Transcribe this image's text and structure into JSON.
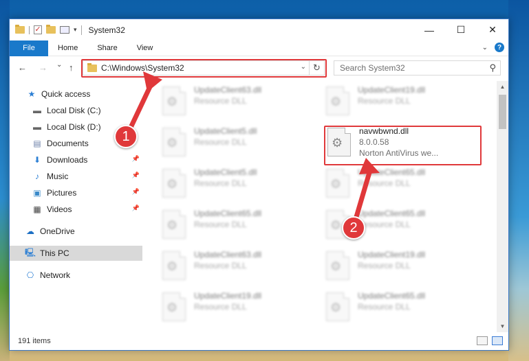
{
  "window": {
    "title": "System32",
    "controls": {
      "minimize": "—",
      "maximize": "☐",
      "close": "✕"
    }
  },
  "ribbon": {
    "tabs": [
      "File",
      "Home",
      "Share",
      "View"
    ],
    "help": "?"
  },
  "navigation": {
    "back": "←",
    "forward": "→",
    "recent": "⌄",
    "up": "↑",
    "address": "C:\\Windows\\System32",
    "refresh": "↻",
    "search_placeholder": "Search System32"
  },
  "sidebar": {
    "items": [
      {
        "label": "Quick access",
        "icon": "star-icon"
      },
      {
        "label": "Local Disk (C:)",
        "icon": "drive-icon"
      },
      {
        "label": "Local Disk (D:)",
        "icon": "drive-icon"
      },
      {
        "label": "Documents",
        "icon": "documents-icon"
      },
      {
        "label": "Downloads",
        "icon": "download-icon",
        "pinned": true
      },
      {
        "label": "Music",
        "icon": "music-icon",
        "pinned": true
      },
      {
        "label": "Pictures",
        "icon": "pictures-icon",
        "pinned": true
      },
      {
        "label": "Videos",
        "icon": "videos-icon",
        "pinned": true
      },
      {
        "label": "OneDrive",
        "icon": "cloud-icon"
      },
      {
        "label": "This PC",
        "icon": "computer-icon",
        "selected": true
      },
      {
        "label": "Network",
        "icon": "network-icon"
      }
    ]
  },
  "files": {
    "left_column": [
      {
        "name": "UpdateClient63.dll",
        "desc": "Resource DLL"
      },
      {
        "name": "UpdateClient5.dll",
        "desc": "Resource DLL"
      },
      {
        "name": "UpdateClient5.dll",
        "desc": "Resource DLL"
      },
      {
        "name": "UpdateClient65.dll",
        "desc": "Resource DLL"
      },
      {
        "name": "UpdateClient63.dll",
        "desc": "Resource DLL"
      },
      {
        "name": "UpdateClient19.dll",
        "desc": "Resource DLL"
      }
    ],
    "right_column": [
      {
        "name": "UpdateClient19.dll",
        "desc": "Resource DLL"
      },
      {
        "name": "UpdateClient65.dll",
        "desc": "Resource DLL"
      },
      {
        "name": "UpdateClient65.dll",
        "desc": "Resource DLL"
      },
      {
        "name": "UpdateClient19.dll",
        "desc": "Resource DLL"
      },
      {
        "name": "UpdateClient65.dll",
        "desc": "Resource DLL"
      }
    ],
    "highlighted": {
      "name": "navwbwnd.dll",
      "version": "8.0.0.58",
      "desc": "Norton AntiVirus we..."
    }
  },
  "status": {
    "count": "191 items"
  },
  "annotations": {
    "step1": "1",
    "step2": "2",
    "color": "#e0383a"
  }
}
